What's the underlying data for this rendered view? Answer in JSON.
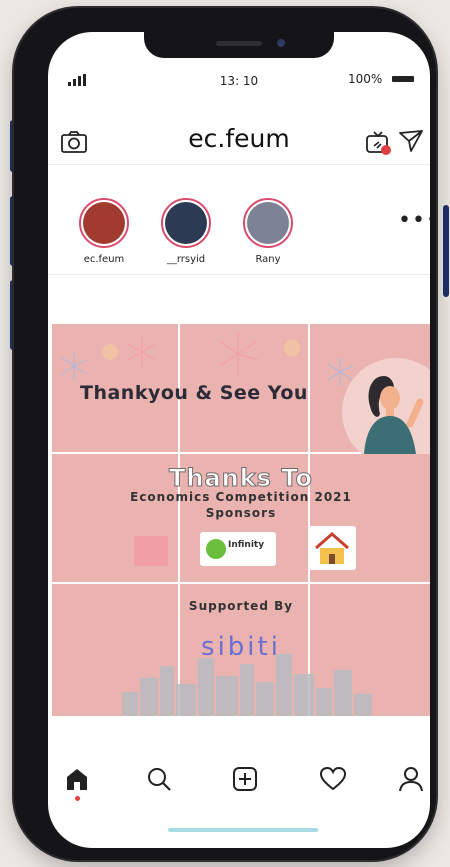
{
  "status": {
    "time": "13: 10",
    "battery": "100%"
  },
  "header": {
    "username": "ec.feum"
  },
  "stories": [
    {
      "name": "ec.feum",
      "color": "#a23b2f"
    },
    {
      "name": "__rrsyid",
      "color": "#2c3a54"
    },
    {
      "name": "Rany",
      "color": "#7d8394"
    }
  ],
  "post": {
    "headline": "Thankyou & See You",
    "thanks_to": "Thanks To",
    "event": "Economics Competition 2021",
    "sponsors_label": "Sponsors",
    "sponsor_logo_text": "Infinity",
    "supported_by": "Supported By",
    "supporter": "sibiti",
    "background": "#eab3b0"
  },
  "nav": [
    "home-icon",
    "search-icon",
    "add-post-icon",
    "heart-icon",
    "profile-icon"
  ],
  "colors": {
    "accent_ring": "#d94c6e",
    "sibiti": "#6a6fd1",
    "home_indicator": "#a6dbe4"
  }
}
